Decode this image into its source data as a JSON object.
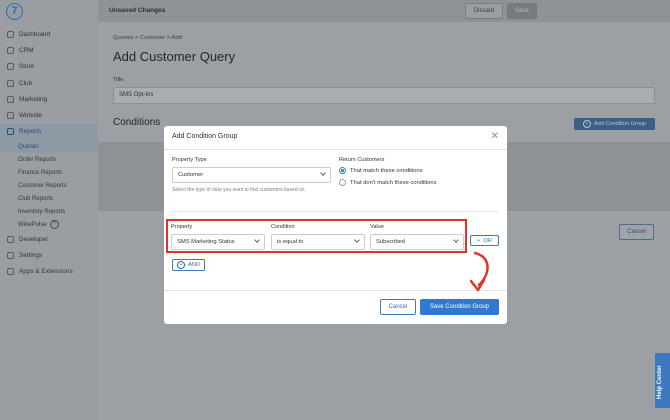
{
  "sidebar": {
    "items": [
      {
        "label": "Dashboard",
        "icon": "dashboard-icon"
      },
      {
        "label": "CRM",
        "icon": "crm-icon"
      },
      {
        "label": "Store",
        "icon": "store-icon"
      },
      {
        "label": "Club",
        "icon": "club-icon"
      },
      {
        "label": "Marketing",
        "icon": "marketing-icon"
      },
      {
        "label": "Website",
        "icon": "website-icon"
      },
      {
        "label": "Reports",
        "icon": "reports-icon"
      }
    ],
    "reports_sub": [
      "Queries",
      "Order Reports",
      "Finance Reports",
      "Customer Reports",
      "Club Reports",
      "Inventory Reports",
      "WinePulse"
    ],
    "bottom_items": [
      {
        "label": "Developer",
        "icon": "developer-icon"
      },
      {
        "label": "Settings",
        "icon": "settings-icon"
      },
      {
        "label": "Apps & Extensions",
        "icon": "apps-icon"
      }
    ],
    "help_glyph": "?"
  },
  "topbar": {
    "status": "Unsaved Changes",
    "discard_label": "Discard",
    "save_label": "Save"
  },
  "main": {
    "breadcrumb": [
      "Queries",
      "Customer",
      "Add"
    ],
    "page_title": "Add Customer Query",
    "title_label": "Title",
    "title_value": "SMS Opt-Ins",
    "conditions_heading": "Conditions",
    "add_condition_group_label": "Add Condition Group",
    "cancel_label": "Cancel"
  },
  "modal": {
    "title": "Add Condition Group",
    "property_type_label": "Property Type",
    "property_type_value": "Customer",
    "property_type_help": "Select the type of data you want to find customers based on",
    "return_customers_label": "Return Customers",
    "radio_match": "That match these conditions",
    "radio_not_match": "That don't match these conditions",
    "property_label": "Property",
    "property_value": "SMS Marketing Status",
    "condition_label": "Condition",
    "condition_value": "is equal to",
    "value_label": "Value",
    "value_value": "Subscribed",
    "or_label": "OR",
    "and_label": "AND",
    "cancel_label": "Cancel",
    "save_label": "Save Condition Group"
  },
  "help_center": "Help Center",
  "colors": {
    "accent": "#2f7ad0",
    "highlight": "#e0332b"
  }
}
